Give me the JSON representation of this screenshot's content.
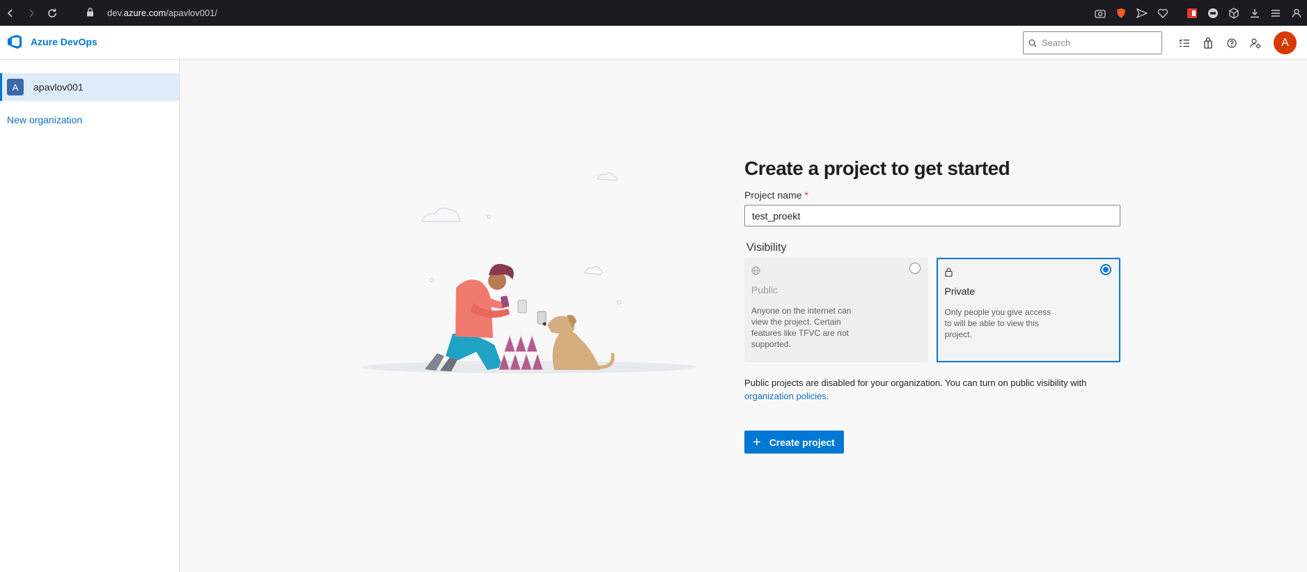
{
  "browser": {
    "url_prefix": "dev.",
    "url_host": "azure.com",
    "url_path": "/apavlov001/"
  },
  "header": {
    "brand": "Azure DevOps",
    "search_placeholder": "Search",
    "avatar_initial": "A",
    "accent_color": "#0078d4",
    "avatar_color": "#d83b01"
  },
  "sidebar": {
    "org_initial": "A",
    "org_name": "apavlov001",
    "new_org_label": "New organization"
  },
  "main": {
    "title": "Create a project to get started",
    "project_name_label": "Project name",
    "required_mark": "*",
    "project_name_value": "test_proekt",
    "visibility_label": "Visibility",
    "visibility_options": [
      {
        "icon": "globe-icon",
        "title": "Public",
        "description": "Anyone on the internet can view the project. Certain features like TFVC are not supported.",
        "selected": false,
        "disabled": true
      },
      {
        "icon": "lock-icon",
        "title": "Private",
        "description": "Only people you give access to will be able to view this project.",
        "selected": true,
        "disabled": false
      }
    ],
    "note_text": "Public projects are disabled for your organization. You can turn on public visibility with",
    "note_link": "organization policies",
    "note_end": ".",
    "create_button_label": "Create project"
  }
}
